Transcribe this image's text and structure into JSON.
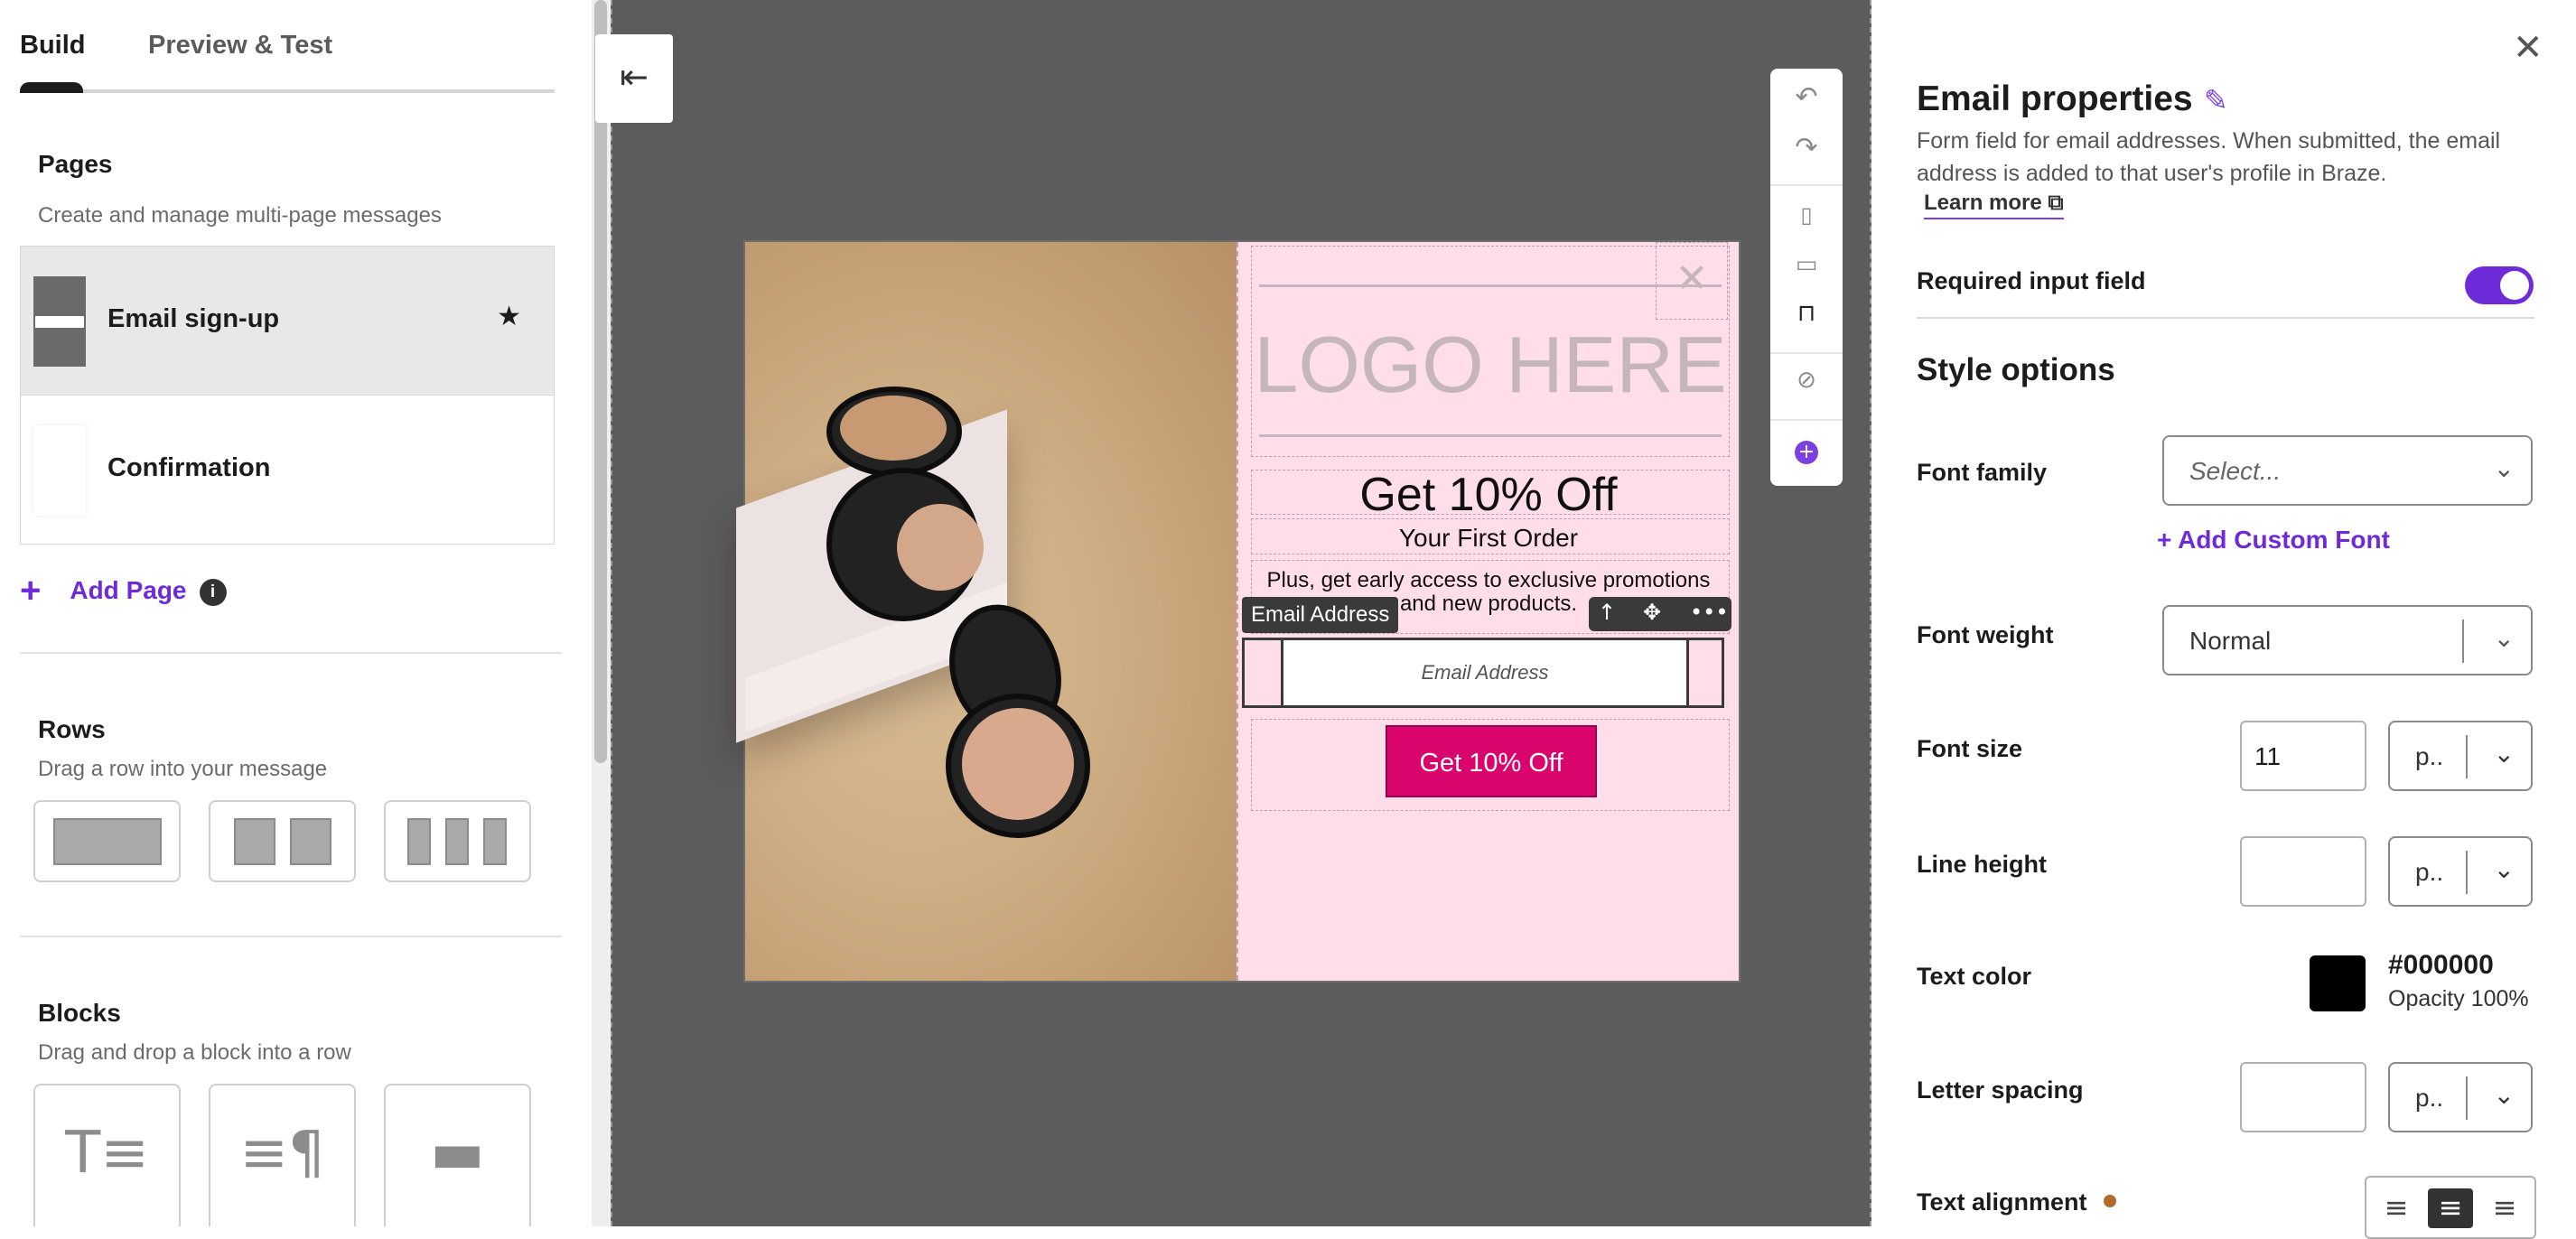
{
  "tabs": {
    "build": "Build",
    "preview": "Preview & Test"
  },
  "pages": {
    "title": "Pages",
    "subtitle": "Create and manage multi-page messages",
    "items": [
      {
        "label": "Email sign-up"
      },
      {
        "label": "Confirmation"
      }
    ],
    "add_label": "Add Page",
    "add_icon": "plus-icon",
    "info_icon": "info-icon"
  },
  "rows": {
    "title": "Rows",
    "subtitle": "Drag a row into your message"
  },
  "blocks": {
    "title": "Blocks",
    "subtitle": "Drag and drop a block into a row"
  },
  "canvas": {
    "logo_text": "LOGO HERE",
    "headline": "Get 10% Off",
    "subheadline": "Your First Order",
    "body_line1": "Plus, get early access to exclusive promotions",
    "body_line2": "and new products.",
    "email_tag": "Email Address",
    "email_placeholder": "Email Address",
    "cta_label": "Get 10% Off",
    "cta_color": "#d9046c",
    "background_color": "#ffdde9"
  },
  "properties": {
    "title": "Email properties",
    "description": "Form field for email addresses. When submitted, the email address is added to that user's profile in Braze.",
    "learn_more": "Learn more",
    "required_label": "Required input field",
    "required_on": true,
    "style_title": "Style options",
    "font_family_label": "Font family",
    "font_family_placeholder": "Select...",
    "add_custom_font": "+ Add Custom Font",
    "font_weight_label": "Font weight",
    "font_weight_value": "Normal",
    "font_size_label": "Font size",
    "font_size_value": "11",
    "font_size_unit": "p..",
    "line_height_label": "Line height",
    "line_height_unit": "p..",
    "text_color_label": "Text color",
    "text_color_hex": "#000000",
    "text_color_opacity": "Opacity 100%",
    "letter_spacing_label": "Letter spacing",
    "letter_spacing_unit": "p..",
    "text_alignment_label": "Text alignment",
    "accent_color": "#6e2bd9"
  }
}
